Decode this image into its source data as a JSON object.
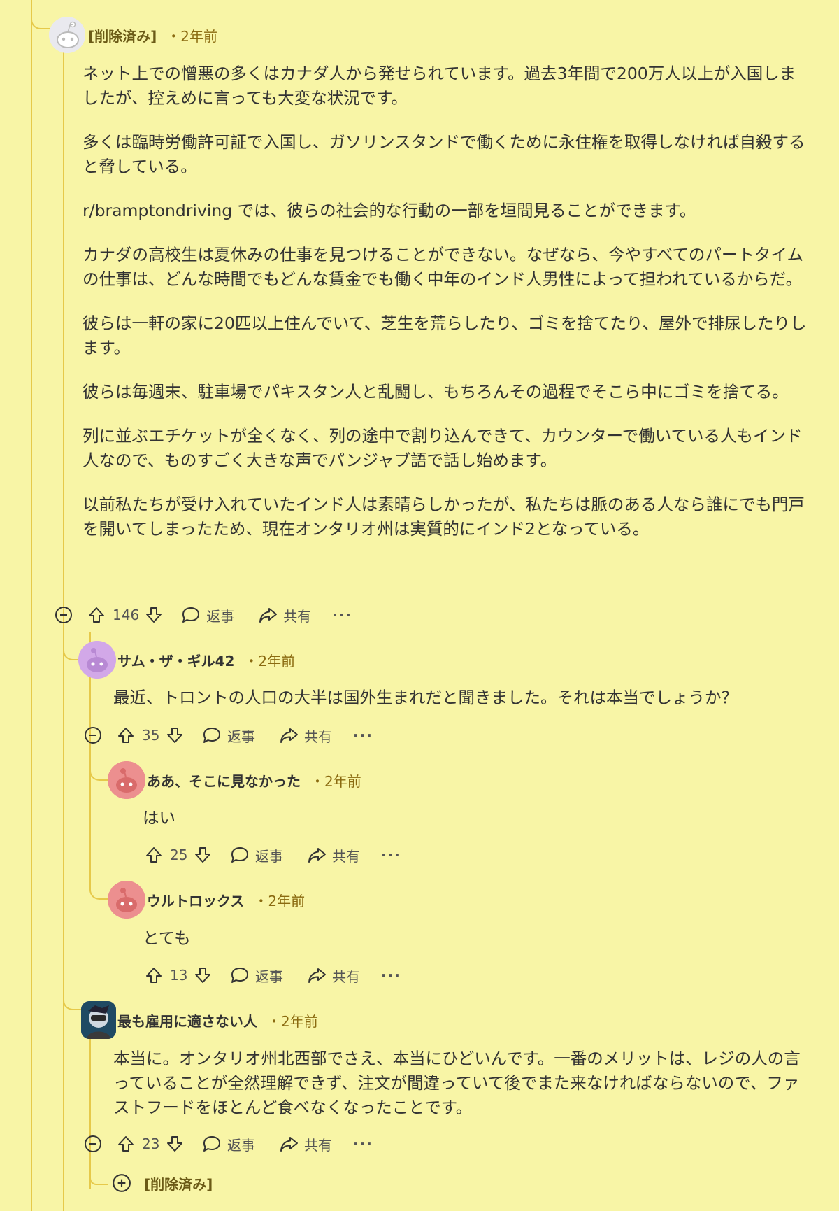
{
  "comments": [
    {
      "author": "[削除済み]",
      "time": "・2年前",
      "paragraphs": [
        "ネット上での憎悪の多くはカナダ人から発せられています。過去3年間で200万人以上が入国しましたが、控えめに言っても大変な状況です。",
        "多くは臨時労働許可証で入国し、ガソリンスタンドで働くために永住権を取得しなければ自殺すると脅している。",
        "r/bramptondriving では、彼らの社会的な行動の一部を垣間見ることができます。",
        "カナダの高校生は夏休みの仕事を見つけることができない。なぜなら、今やすべてのパートタイムの仕事は、どんな時間でもどんな賃金でも働く中年のインド人男性によって担われているからだ。",
        "彼らは一軒の家に20匹以上住んでいて、芝生を荒らしたり、ゴミを捨てたり、屋外で排尿したりします。",
        "彼らは毎週末、駐車場でパキスタン人と乱闘し、もちろんその過程でそこら中にゴミを捨てる。",
        "列に並ぶエチケットが全くなく、列の途中で割り込んできて、カウンターで働いている人もインド人なので、ものすごく大きな声でパンジャブ語で話し始めます。",
        "以前私たちが受け入れていたインド人は素晴らしかったが、私たちは脈のある人なら誰にでも門戸を開いてしまったため、現在オンタリオ州は実質的にインド2となっている。"
      ],
      "votes": "146"
    },
    {
      "author": "サム・ザ・ギル42",
      "time": "・2年前",
      "paragraphs": [
        "最近、トロントの人口の大半は国外生まれだと聞きました。それは本当でしょうか？"
      ],
      "votes": "35"
    },
    {
      "author": "ああ、そこに見なかった",
      "time": "・2年前",
      "paragraphs": [
        "はい"
      ],
      "votes": "25"
    },
    {
      "author": "ウルトロックス",
      "time": "・2年前",
      "paragraphs": [
        "とても"
      ],
      "votes": "13"
    },
    {
      "author": "最も雇用に適さない人",
      "time": "・2年前",
      "paragraphs": [
        "本当に。オンタリオ州北西部でさえ、本当にひどいんです。一番のメリットは、レジの人の言っていることが全然理解できず、注文が間違っていて後でまた来なければならないので、ファストフードをほとんど食べなくなったことです。"
      ],
      "votes": "23"
    }
  ],
  "collapsed_reply": {
    "author": "[削除済み]"
  },
  "actions": {
    "reply": "返事",
    "share": "共有",
    "more": "···"
  },
  "icons": {
    "collapse": "minus-circle-icon",
    "expand": "plus-circle-icon",
    "upvote": "arrow-up-icon",
    "downvote": "arrow-down-icon",
    "reply": "speech-bubble-icon",
    "share": "share-arrow-icon"
  },
  "colors": {
    "background": "#f8f5a6",
    "thread_line": "#e6c94a",
    "meta": "#8a6a10",
    "avatar_purple": "#d2a8e8",
    "avatar_pink": "#ec8f8f"
  }
}
